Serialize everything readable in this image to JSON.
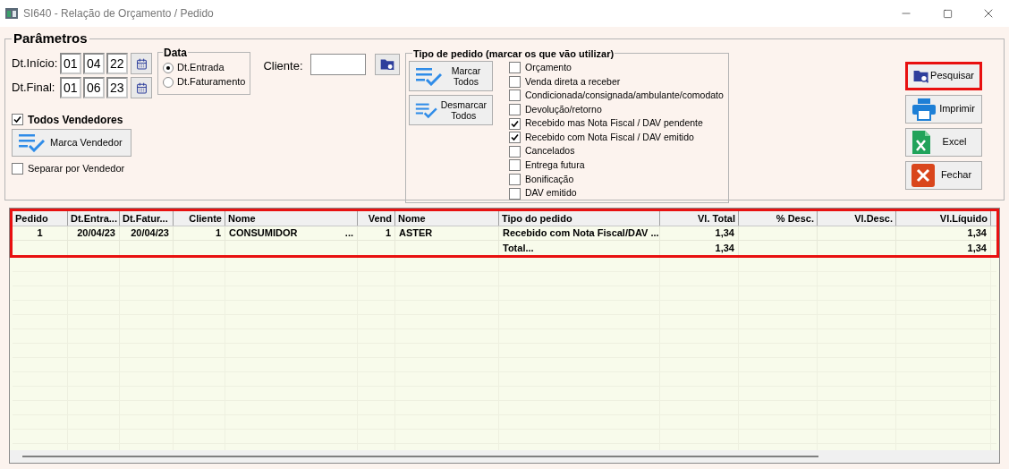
{
  "window": {
    "title": "SI640 - Relação de Orçamento / Pedido"
  },
  "parameters": {
    "title": "Parâmetros",
    "start": {
      "label": "Dt.Início:",
      "day": "01",
      "month": "04",
      "year": "22"
    },
    "end": {
      "label": "Dt.Final:",
      "day": "01",
      "month": "06",
      "year": "23"
    },
    "date_group": {
      "title": "Data",
      "options": [
        {
          "label": "Dt.Entrada",
          "selected": true
        },
        {
          "label": "Dt.Faturamento",
          "selected": false
        }
      ]
    },
    "client": {
      "label": "Cliente:"
    },
    "all_sellers": {
      "label": "Todos Vendedores",
      "checked": true
    },
    "mark_seller_button": "Marca Vendedor",
    "split_by_seller": {
      "label": "Separar por Vendedor",
      "checked": false
    },
    "order_types": {
      "title": "Tipo de pedido (marcar os que vão utilizar)",
      "mark_all": [
        "Marcar",
        "Todos"
      ],
      "unmark_all": [
        "Desmarcar",
        "Todos"
      ],
      "items": [
        {
          "label": "Orçamento",
          "checked": false
        },
        {
          "label": "Venda direta a receber",
          "checked": false
        },
        {
          "label": "Condicionada/consignada/ambulante/comodato",
          "checked": false
        },
        {
          "label": "Devolução/retorno",
          "checked": false
        },
        {
          "label": "Recebido mas Nota Fiscal / DAV pendente",
          "checked": true
        },
        {
          "label": "Recebido com Nota Fiscal / DAV emitido",
          "checked": true
        },
        {
          "label": "Cancelados",
          "checked": false
        },
        {
          "label": "Entrega futura",
          "checked": false
        },
        {
          "label": "Bonificação",
          "checked": false
        },
        {
          "label": "DAV emitido",
          "checked": false
        }
      ]
    }
  },
  "actions": [
    {
      "kind": "search",
      "label": "Pesquisar",
      "highlighted": true
    },
    {
      "kind": "print",
      "label": "Imprimir",
      "highlighted": false
    },
    {
      "kind": "excel",
      "label": "Excel",
      "highlighted": false
    },
    {
      "kind": "close",
      "label": "Fechar",
      "highlighted": false
    }
  ],
  "table": {
    "highlighted": true,
    "columns": [
      {
        "label": "Pedido"
      },
      {
        "label": "Dt.Entra..."
      },
      {
        "label": "Dt.Fatur..."
      },
      {
        "label": "Cliente"
      },
      {
        "label": "Nome"
      },
      {
        "label": "Vend"
      },
      {
        "label": "Nome"
      },
      {
        "label": "Tipo do pedido"
      },
      {
        "label": "Vl. Total"
      },
      {
        "label": "% Desc."
      },
      {
        "label": "Vl.Desc."
      },
      {
        "label": "Vl.Líquido"
      }
    ],
    "rows": [
      {
        "cells": [
          {
            "text": "1"
          },
          {
            "text": "20/04/23"
          },
          {
            "text": "20/04/23"
          },
          {
            "text": "1"
          },
          {
            "text": "CONSUMIDOR",
            "more": "..."
          },
          {
            "text": "1"
          },
          {
            "text": "ASTER"
          },
          {
            "text": "Recebido com Nota Fiscal/DAV ..."
          },
          {
            "text": "1,34"
          },
          null,
          null,
          {
            "text": "1,34"
          }
        ]
      }
    ],
    "total": {
      "label": "Total...",
      "total_value": "1,34",
      "net_value": "1,34"
    }
  }
}
